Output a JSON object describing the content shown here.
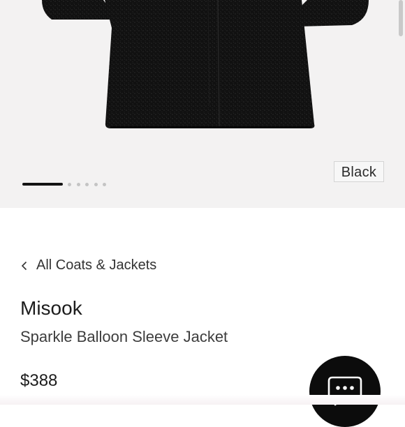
{
  "product_image": {
    "alt": "Black sparkle balloon sleeve jacket",
    "swatch_color": "#121212"
  },
  "color_badge": {
    "label": "Black"
  },
  "carousel": {
    "total_slides": 6,
    "active_slide": 1
  },
  "breadcrumb": {
    "label": "All Coats & Jackets",
    "icon": "chevron-left-icon"
  },
  "product": {
    "brand": "Misook",
    "name": "Sparkle Balloon Sleeve Jacket",
    "price": "$388"
  },
  "chat": {
    "icon": "chat-bubble-icon"
  },
  "colors": {
    "hero_background": "#f3f2f2",
    "accent": "#0c0c0c"
  }
}
